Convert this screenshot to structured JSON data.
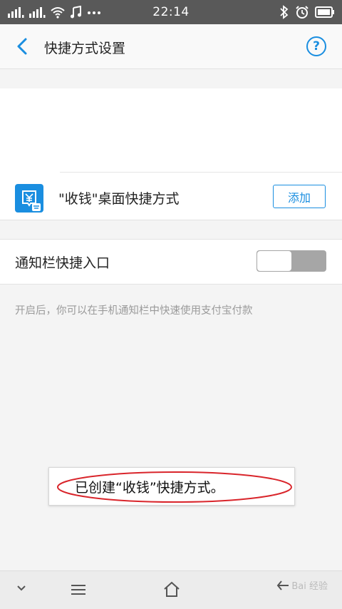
{
  "status_bar": {
    "time": "22:14",
    "icons": [
      "signal-icon",
      "signal-icon",
      "wifi-icon",
      "music-icon",
      "more-icon",
      "bluetooth-icon",
      "alarm-icon",
      "battery-icon"
    ]
  },
  "header": {
    "title": "快捷方式设置",
    "help_label": "?"
  },
  "shortcut": {
    "label": "\"收钱\"桌面快捷方式",
    "add_label": "添加"
  },
  "notification": {
    "label": "通知栏快捷入口",
    "toggle_on": false,
    "description": "开启后，你可以在手机通知栏中快速使用支付宝付款"
  },
  "toast": {
    "message": "已创建“收钱”快捷方式。"
  },
  "watermark": {
    "text": "Bai 经验"
  },
  "colors": {
    "accent": "#1a8ee0",
    "annotation": "#d9252b"
  }
}
